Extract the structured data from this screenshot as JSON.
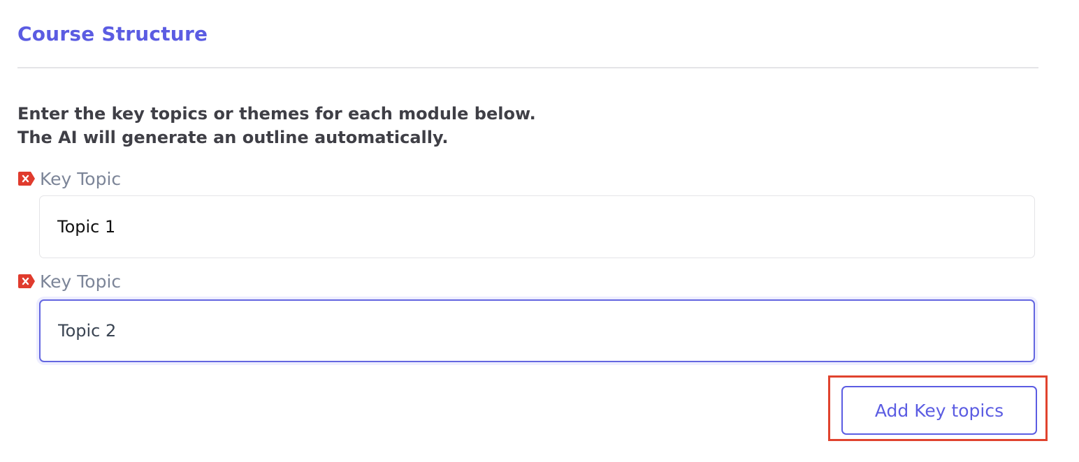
{
  "section": {
    "title": "Course Structure"
  },
  "instructions": {
    "line1": "Enter the key topics or themes for each module below.",
    "line2": "The AI will generate an outline automatically."
  },
  "topics": [
    {
      "label": "Key Topic",
      "value": "Topic 1",
      "remove_icon": "remove-x-icon",
      "focused": false
    },
    {
      "label": "Key Topic",
      "value": "Topic 2",
      "remove_icon": "remove-x-icon",
      "focused": true
    }
  ],
  "actions": {
    "add_label": "Add Key topics"
  },
  "colors": {
    "accent": "#5b5ce2",
    "remove_icon": "#e03b2d",
    "highlight": "#e0432e",
    "label": "#7c8598"
  }
}
